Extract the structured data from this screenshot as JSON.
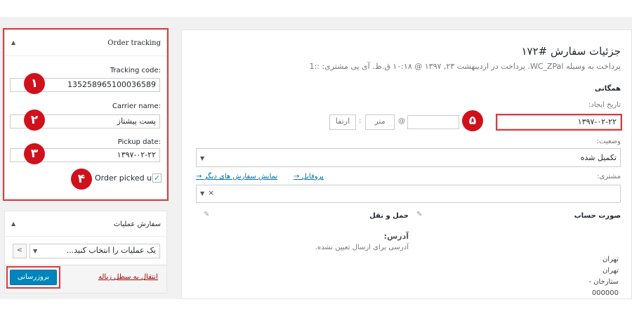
{
  "order_tracking": {
    "title": "Order tracking",
    "tracking_code_label": "Tracking code:",
    "tracking_code_value": "135258965100036589",
    "carrier_name_label": "Carrier name:",
    "carrier_name_value": "پست پیشتاز",
    "pickup_date_label": "Pickup date:",
    "pickup_date_value": "۱۳۹۷-۰۲-۲۲",
    "picked_up_label": "Order picked up",
    "picked_up_checked": true
  },
  "order_actions": {
    "title": "سفارش عملیات",
    "select_value": "یک عملیات را انتخاب کنید...",
    "apply_button": "<",
    "trash_link": "انتقال به سطل زباله",
    "update_button": "بروزرسانی"
  },
  "badges": [
    "۱",
    "۲",
    "۳",
    "۴",
    "۵"
  ],
  "order": {
    "title": "جزئیات سفارش #۱۷۲",
    "subtitle": "پرداخت به وسیله WC_ZPal. پرداخت در اردیبهشت ۲۳, ۱۳۹۷ @ ۱۰:۱۸ ق.ظ. آی پی مشتری: ::1",
    "general_heading": "همگانی",
    "date_created_label": "تاریخ ایجاد:",
    "date_created_value": "۱۳۹۷-۰۲-۲۲",
    "at_symbol": "@",
    "colon": ":",
    "hour_placeholder": "ارتفا",
    "minute_placeholder": "متر",
    "status_label": "وضعیت:",
    "status_value": "تکمیل شده",
    "customer_label": "مشتری:",
    "profile_link": "پروفایل →",
    "other_orders_link": "نمایش سفارش های دیگر →",
    "customer_clear": "×",
    "billing_heading": "صورت حساب",
    "shipping_heading": "حمل و نقل",
    "address_heading": "آدرس:",
    "no_address_text": "آدرسی برای ارسال تعیین نشده.",
    "billing_lines": [
      "تهران",
      "تهران",
      "ستارخان -",
      "000000"
    ]
  },
  "colors": {
    "accent": "#0085ba",
    "highlight": "#e0393e",
    "badge": "#d0111b"
  }
}
